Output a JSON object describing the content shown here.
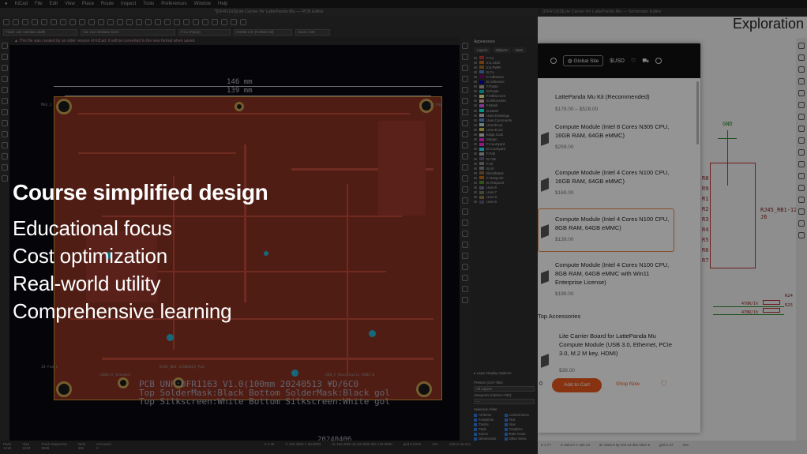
{
  "menubar": {
    "app": "KiCad",
    "items": [
      "File",
      "Edit",
      "View",
      "Place",
      "Route",
      "Inspect",
      "Tools",
      "Preferences",
      "Window",
      "Help"
    ]
  },
  "pcb_editor": {
    "title": "*[DFR1163]Lite Carrier for LattePanda Mu — PCB Editor",
    "toolbar": {
      "track_width": "Track: use netclass width",
      "via_size": "Via: use netclass sizes",
      "layer": "F.Cu (PgUp)",
      "grid": "0.0250 mm (0.9843 mil)",
      "zoom": "Zoom 4.29"
    },
    "warning": "This file was created by an older version of KiCad. It will be converted to the new format when saved.",
    "dimension_outer": "146 mm",
    "dimension_inner": "139 mm",
    "silk_line1": "PCB UNF:DFR1163 V1.0(100mm 20240513 ¥D/6C0",
    "silk_line2": "Top SolderMask:Black  Bottom SolderMask:Black  gol",
    "silk_line3": "Top Silkscreen:White  Bottom Silkscreen:White  gol",
    "date_label": "20240406",
    "labels": {
      "bl_fan": "J8-Fan_L",
      "usb_a": "USB3.A_Stacked",
      "fan_right": "USB_C_Receptacle_USB2.0",
      "top_left": "MH3_1",
      "top_right": "J3_Pad",
      "l_left": "RJ45_RB1-125BAG1A_Pad"
    },
    "status": [
      {
        "label": "Pads",
        "value": "1218"
      },
      {
        "label": "Vias",
        "value": "1020"
      },
      {
        "label": "Track Segments",
        "value": "3598"
      },
      {
        "label": "Nets",
        "value": "392"
      },
      {
        "label": "Unrouted",
        "value": "0"
      }
    ],
    "statusbar_extra": [
      "Z 2.36",
      "X 169.4000  Y 68.8000",
      "dx 169.4000  dy 83.8000  dist 178.9000",
      "grid 0.0250",
      "mm",
      "Select item(s)"
    ]
  },
  "appearance": {
    "title": "Appearance",
    "tabs": [
      "Layers",
      "Objects",
      "Nets"
    ],
    "layers": [
      {
        "name": "F.Cu",
        "color": "#c83434"
      },
      {
        "name": "In1.GND",
        "color": "#c26419"
      },
      {
        "name": "In2.PWR",
        "color": "#a16b24"
      },
      {
        "name": "B.Cu",
        "color": "#4d7fc4"
      },
      {
        "name": "F.Adhesive",
        "color": "#8d0073"
      },
      {
        "name": "B.Adhesive",
        "color": "#0000ba"
      },
      {
        "name": "F.Paste",
        "color": "#b4a0a0"
      },
      {
        "name": "B.Paste",
        "color": "#00c2c2"
      },
      {
        "name": "F.Silkscreen",
        "color": "#f2eda1"
      },
      {
        "name": "B.Silkscreen",
        "color": "#e8b2a7"
      },
      {
        "name": "F.Mask",
        "color": "#d864ff"
      },
      {
        "name": "B.Mask",
        "color": "#02ffee"
      },
      {
        "name": "User.Drawings",
        "color": "#c2c2c2"
      },
      {
        "name": "User.Comments",
        "color": "#5994dc"
      },
      {
        "name": "User.Eco1",
        "color": "#b4dbd2"
      },
      {
        "name": "User.Eco2",
        "color": "#d8c852"
      },
      {
        "name": "Edge.Cuts",
        "color": "#d0d2cd"
      },
      {
        "name": "Margin",
        "color": "#ff26e2"
      },
      {
        "name": "F.Courtyard",
        "color": "#ff26e2"
      },
      {
        "name": "B.Courtyard",
        "color": "#26e9ff"
      },
      {
        "name": "F.Fab",
        "color": "#afafaf"
      },
      {
        "name": "B.Fab",
        "color": "#585d84"
      },
      {
        "name": "F.Inf",
        "color": "#888888"
      },
      {
        "name": "B.Inf",
        "color": "#888888"
      },
      {
        "name": "BlockMask",
        "color": "#8a6a3a"
      },
      {
        "name": "F.Testpoint",
        "color": "#bf6a18"
      },
      {
        "name": "B.Testpoint",
        "color": "#5a8a30"
      },
      {
        "name": "User.6",
        "color": "#7a6a8a"
      },
      {
        "name": "User.7",
        "color": "#6a7a5a"
      },
      {
        "name": "User.8",
        "color": "#8a7a4a"
      },
      {
        "name": "User.9",
        "color": "#5a5a7a"
      }
    ],
    "layer_display_options": "▸ Layer Display Options",
    "presets_label": "Presets (Ctrl+Tab):",
    "presets_value": "All Layers",
    "viewports_label": "Viewports (Option+Tab):",
    "viewports_value": "---",
    "selection_filter_label": "Selection Filter",
    "selection_filter": [
      "All items",
      "Locked items",
      "Footprints",
      "Text",
      "Tracks",
      "Vias",
      "Pads",
      "Graphics",
      "Zones",
      "Rule Areas",
      "Dimensions",
      "Other items"
    ]
  },
  "schematic": {
    "title": "[DFR1163]Lite Carrier for LattePanda Mu — Schematic Editor",
    "corner_label": "Exploration",
    "gnd": "GND",
    "rj45": "RJ45_RB1-12",
    "j6": "J6",
    "r_labels": [
      "R8",
      "R9",
      "R1",
      "R2",
      "R3",
      "R4",
      "R5",
      "R6",
      "R7"
    ],
    "res_left": [
      "470R/1%",
      "470R/1%"
    ],
    "res_right": [
      "R24",
      "R25"
    ],
    "status": [
      "Z 1.77",
      "X 1524.0  Y 104.14",
      "dx 1524.0  dy 104.14  dist 1527.5",
      "grid 1.27",
      "mm"
    ]
  },
  "store": {
    "nav_global": "Global Site",
    "nav_currency": "$USD",
    "products": [
      {
        "name": "LattePanda Mu Kit (Recommended)",
        "price": "$178.00 – $528.00"
      },
      {
        "name": "Compute Module (Intel 8 Cores N305 CPU, 16GB RAM, 64GB eMMC)",
        "price": "$259.00"
      },
      {
        "name": "Compute Module (Intel 4 Cores N100 CPU, 16GB RAM, 64GB eMMC)",
        "price": "$169.00"
      },
      {
        "name": "Compute Module (Intel 4 Cores N100 CPU, 8GB RAM, 64GB eMMC)",
        "price": "$139.00"
      },
      {
        "name": "Compute Module (Intel 4 Cores N100 CPU, 8GB RAM, 64GB eMMC with Win11 Enterprise License)",
        "price": "$199.00"
      }
    ],
    "top_accessories": "Top Accessories",
    "accessory": {
      "name": "Lite Carrier Board for LattePanda Mu Compute Module (USB 3.0, Ethernet, PCIe 3.0, M.2 M key, HDMI)",
      "price": "$39.00"
    },
    "qty_stub": "0",
    "add_to_cart": "Add to Cart",
    "shop_now": "Shop Now"
  },
  "overlay": {
    "headline": "Course simplified design",
    "points": [
      "Educational focus",
      "Cost optimization",
      "Real-world utility",
      "Comprehensive learning"
    ]
  },
  "colors": {
    "board_copper": "#8a3324",
    "accent_orange": "#e8591f",
    "via_cyan": "#27b6d6"
  }
}
